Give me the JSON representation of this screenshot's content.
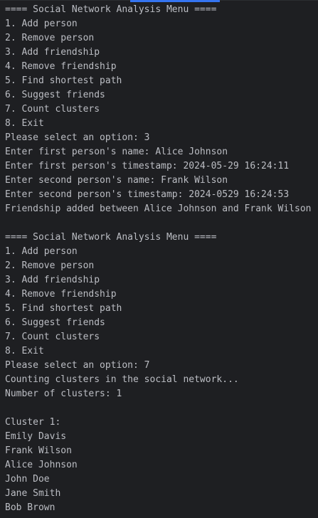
{
  "console": {
    "lines": [
      "==== Social Network Analysis Menu ====",
      "1. Add person",
      "2. Remove person",
      "3. Add friendship",
      "4. Remove friendship",
      "5. Find shortest path",
      "6. Suggest friends",
      "7. Count clusters",
      "8. Exit",
      "Please select an option: 3",
      "Enter first person's name: Alice Johnson",
      "Enter first person's timestamp: 2024-05-29 16:24:11",
      "Enter second person's name: Frank Wilson",
      "Enter second person's timestamp: 2024-0529 16:24:53",
      "Friendship added between Alice Johnson and Frank Wilson",
      "",
      "==== Social Network Analysis Menu ====",
      "1. Add person",
      "2. Remove person",
      "3. Add friendship",
      "4. Remove friendship",
      "5. Find shortest path",
      "6. Suggest friends",
      "7. Count clusters",
      "8. Exit",
      "Please select an option: 7",
      "Counting clusters in the social network...",
      "Number of clusters: 1",
      "",
      "Cluster 1:",
      "Emily Davis",
      "Frank Wilson",
      "Alice Johnson",
      "John Doe",
      "Jane Smith",
      "Bob Brown"
    ]
  },
  "colors": {
    "background": "#1e1f22",
    "text": "#bcbec4",
    "scroll_indicator": "#3574f0"
  }
}
